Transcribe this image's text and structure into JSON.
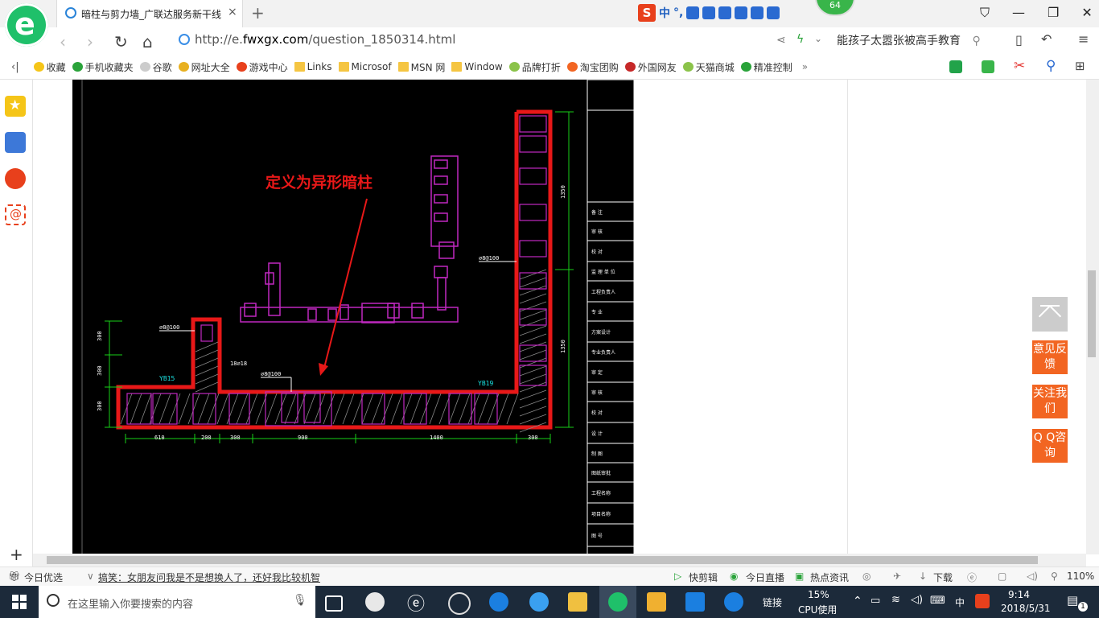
{
  "browser": {
    "badge_count": "64",
    "tab_title": "暗柱与剪力墙_广联达服务新干线",
    "tab_close": "×",
    "new_tab": "+",
    "ime": {
      "logo": "S",
      "lang": "中",
      "punct": "°,"
    },
    "url_prefix": "http://e.",
    "url_domain": "fwxgx.com",
    "url_path": "/question_1850314.html",
    "search_text": "能孩子太嚣张被高手教育",
    "bookmarks": [
      {
        "label": "收藏",
        "icon": "star-icon"
      },
      {
        "label": "手机收藏夹",
        "icon": "phone-icon"
      },
      {
        "label": "谷歌",
        "icon": "page-icon"
      },
      {
        "label": "网址大全",
        "icon": "globe-icon"
      },
      {
        "label": "游戏中心",
        "icon": "game-icon"
      },
      {
        "label": "Links",
        "icon": "folder-icon"
      },
      {
        "label": "Microsof",
        "icon": "folder-icon"
      },
      {
        "label": "MSN 网",
        "icon": "folder-icon"
      },
      {
        "label": "Window",
        "icon": "folder-icon"
      },
      {
        "label": "品牌打折",
        "icon": "leaf-icon"
      },
      {
        "label": "淘宝团购",
        "icon": "taobao-icon"
      },
      {
        "label": "外国网友",
        "icon": "flag-icon"
      },
      {
        "label": "天猫商城",
        "icon": "leaf-icon"
      },
      {
        "label": "精准控制",
        "icon": "wechat-icon"
      }
    ],
    "bookmarks_more": "»"
  },
  "cad": {
    "annotation": "定义为异形暗柱",
    "dims_bottom": [
      "610",
      "200",
      "300",
      "900",
      "1400",
      "300"
    ],
    "dims_left": [
      "300",
      "300",
      "300"
    ],
    "dims_right": [
      "1350",
      "1350"
    ],
    "labels": {
      "yb15": "YB15",
      "yb19": "YB19",
      "rebar1": "⌀8@100",
      "rebar2": "⌀8@100",
      "rebar3": "⌀8@100",
      "rebar4": "18⌀18"
    },
    "title_rows": [
      "备 注",
      "审 核",
      "校 对",
      "监 理 单 位",
      "工程负责人",
      "专 业",
      "方案设计",
      "专业负责人",
      "审 定",
      "审 核",
      "校 对",
      "设 计",
      "制 图",
      "图纸审批",
      "工程名称",
      "项目名称",
      "图 号"
    ]
  },
  "floating": {
    "feedback": "意见反馈",
    "follow": "关注我们",
    "qq": "Q Q咨询"
  },
  "statusbar": {
    "left": "今日优选",
    "news": "搞笑：女朋友问我是不是想换人了，还好我比较机智",
    "quick_clip": "快剪辑",
    "live": "今日直播",
    "hot": "热点资讯",
    "download": "下载",
    "zoom": "110%"
  },
  "taskbar": {
    "search_placeholder": "在这里输入你要搜索的内容",
    "links": "链接",
    "cpu_percent": "15%",
    "cpu_label": "CPU使用",
    "ime_lang": "中",
    "time": "9:14",
    "date": "2018/5/31",
    "notifications": "1"
  }
}
